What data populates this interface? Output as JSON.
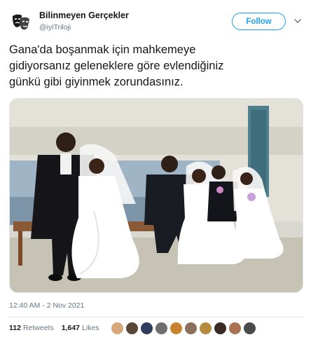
{
  "user": {
    "display_name": "Bilinmeyen Gerçekler",
    "handle": "@iyiTriloji",
    "avatar_icon": "theater-masks-icon"
  },
  "follow_label": "Follow",
  "menu_icon": "chevron-down-icon",
  "tweet": {
    "lines": [
      "Gana'da boşanmak için mahkemeye",
      "gidiyorsanız geleneklere göre evlendiğiniz",
      "günkü gibi giyinmek zorundasınız."
    ]
  },
  "timestamp": "12:40 AM - 2 Nov 2021",
  "stats": {
    "retweets_count": "112",
    "retweets_label": "Retweets",
    "likes_count": "1,647",
    "likes_label": "Likes"
  },
  "colors": {
    "accent": "#1da1f2",
    "text": "#14171a",
    "secondary": "#657786",
    "border": "#e1e8ed"
  },
  "likers": [
    "#d6a77a",
    "#5b4636",
    "#2f3e5c",
    "#6e6e6e",
    "#c9832f",
    "#8a6f5a",
    "#b58c3e",
    "#3b2b22",
    "#a97352",
    "#4a4a4a"
  ]
}
